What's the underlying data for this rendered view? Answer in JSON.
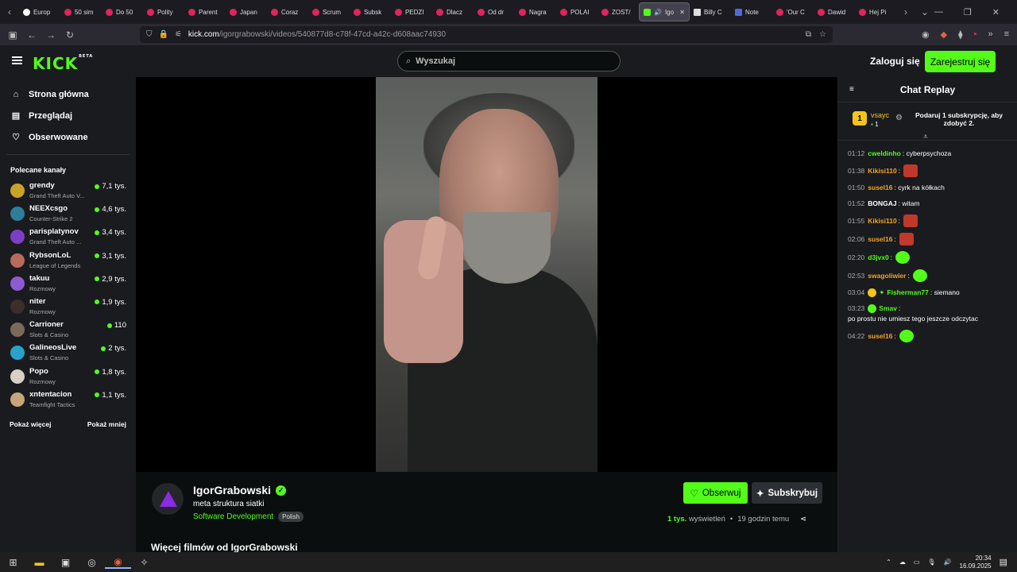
{
  "browser": {
    "tabs": [
      {
        "label": "Europ",
        "icon": "globe-icon"
      },
      {
        "label": "50 sim",
        "icon": "youtube-icon"
      },
      {
        "label": "Do 50",
        "icon": "youtube-icon"
      },
      {
        "label": "Polity",
        "icon": "youtube-icon"
      },
      {
        "label": "Parent",
        "icon": "youtube-icon"
      },
      {
        "label": "Japan",
        "icon": "youtube-icon"
      },
      {
        "label": "Coraz",
        "icon": "youtube-icon"
      },
      {
        "label": "Scrum",
        "icon": "youtube-icon"
      },
      {
        "label": "Subsk",
        "icon": "youtube-icon"
      },
      {
        "label": "PEDZI",
        "icon": "youtube-icon"
      },
      {
        "label": "Dlacz",
        "icon": "youtube-icon"
      },
      {
        "label": "Od dr",
        "icon": "youtube-icon"
      },
      {
        "label": "Nagra",
        "icon": "youtube-icon"
      },
      {
        "label": "POLAI",
        "icon": "youtube-icon"
      },
      {
        "label": "ZOST/",
        "icon": "youtube-icon"
      },
      {
        "label": "Igo",
        "icon": "kick-icon",
        "active": true
      },
      {
        "label": "Billy C",
        "icon": "x-icon"
      },
      {
        "label": "Note",
        "icon": "note-icon"
      },
      {
        "label": "'Our C",
        "icon": "youtube-icon"
      },
      {
        "label": "Dawid",
        "icon": "youtube-icon"
      },
      {
        "label": "Hej Pi",
        "icon": "youtube-icon"
      }
    ],
    "url_host": "kick.com",
    "url_path": "/igorgrabowski/videos/540877d8-c78f-47cd-a42c-d608aac74930"
  },
  "header": {
    "logo": "KICK",
    "logo_badge": "BETA",
    "search_placeholder": "Wyszukaj",
    "login": "Zaloguj się",
    "register": "Zarejestruj się"
  },
  "sidebar": {
    "nav": [
      {
        "label": "Strona główna",
        "icon": "home-icon"
      },
      {
        "label": "Przeglądaj",
        "icon": "browse-icon"
      },
      {
        "label": "Obserwowane",
        "icon": "heart-icon"
      }
    ],
    "recommended_title": "Polecane kanały",
    "channels": [
      {
        "name": "grendy",
        "category": "Grand Theft Auto V...",
        "viewers": "7,1 tys.",
        "color": "#c9a227"
      },
      {
        "name": "NEEXcsgo",
        "category": "Counter-Strike 2",
        "viewers": "4,6 tys.",
        "color": "#2e7d9a"
      },
      {
        "name": "parisplatynov",
        "category": "Grand Theft Auto ...",
        "viewers": "3,4 tys.",
        "color": "#7b3fc4"
      },
      {
        "name": "RybsonLoL",
        "category": "League of Legends",
        "viewers": "3,1 tys.",
        "color": "#b86a5c"
      },
      {
        "name": "takuu",
        "category": "Rozmowy",
        "viewers": "2,9 tys.",
        "color": "#8e5bd1"
      },
      {
        "name": "niter",
        "category": "Rozmowy",
        "viewers": "1,9 tys.",
        "color": "#3a2f2a"
      },
      {
        "name": "Carrioner",
        "category": "Slots & Casino",
        "viewers": "110",
        "color": "#7a6a5a"
      },
      {
        "name": "GalineosLive",
        "category": "Slots & Casino",
        "viewers": "2 tys.",
        "color": "#2aa1c9"
      },
      {
        "name": "Popo",
        "category": "Rozmowy",
        "viewers": "1,8 tys.",
        "color": "#d8d0c4"
      },
      {
        "name": "xntentacion",
        "category": "Teamfight Tactics",
        "viewers": "1,1 tys.",
        "color": "#c7a47a"
      }
    ],
    "show_more": "Pokaż więcej",
    "show_less": "Pokaż mniej"
  },
  "video_info": {
    "channel": "IgorGrabowski",
    "title": "meta struktura siatki",
    "category": "Software Development",
    "tag": "Polish",
    "follow": "Obserwuj",
    "subscribe": "Subskrybuj",
    "views_count": "1 tys.",
    "views_label": "wyświetleń",
    "time_ago": "19 godzin temu",
    "more_videos": "Więcej filmów od IgorGrabowski"
  },
  "chat": {
    "title": "Chat Replay",
    "pinned": {
      "user": "vsayc",
      "badge": "1",
      "count": "1",
      "message": "Podaruj 1 subskrypcję, aby zdobyć 2."
    },
    "messages": [
      {
        "time": "01:12",
        "user": "cweldinho",
        "color": "#53fc18",
        "text": "cyberpsychoza"
      },
      {
        "time": "01:38",
        "user": "Kikisi110",
        "color": "#f5a623",
        "text": "",
        "emote": "red"
      },
      {
        "time": "01:50",
        "user": "susel16",
        "color": "#f5a623",
        "text": "cyrk na kółkach"
      },
      {
        "time": "01:52",
        "user": "BONGAJ",
        "color": "#ffffff",
        "text": "witam"
      },
      {
        "time": "01:55",
        "user": "Kikisi110",
        "color": "#f5a623",
        "text": "",
        "emote": "red"
      },
      {
        "time": "02:06",
        "user": "susel16",
        "color": "#f5a623",
        "text": "",
        "emote": "red"
      },
      {
        "time": "02:20",
        "user": "d3jvx0",
        "color": "#53fc18",
        "text": "",
        "emote": "grn"
      },
      {
        "time": "02:53",
        "user": "swagoliwier",
        "color": "#f5a623",
        "text": "",
        "emote": "grn"
      },
      {
        "time": "03:04",
        "user": "Fisherman77",
        "color": "#53fc18",
        "text": "siemano"
      },
      {
        "time": "03:23",
        "user": "Smav",
        "color": "#53fc18",
        "text": "po prostu nie umiesz tego jeszcze odczytac"
      },
      {
        "time": "04:22",
        "user": "susel16",
        "color": "#f5a623",
        "text": "",
        "emote": "grn"
      }
    ]
  },
  "taskbar": {
    "time": "20:34",
    "date": "16.09.2025"
  }
}
